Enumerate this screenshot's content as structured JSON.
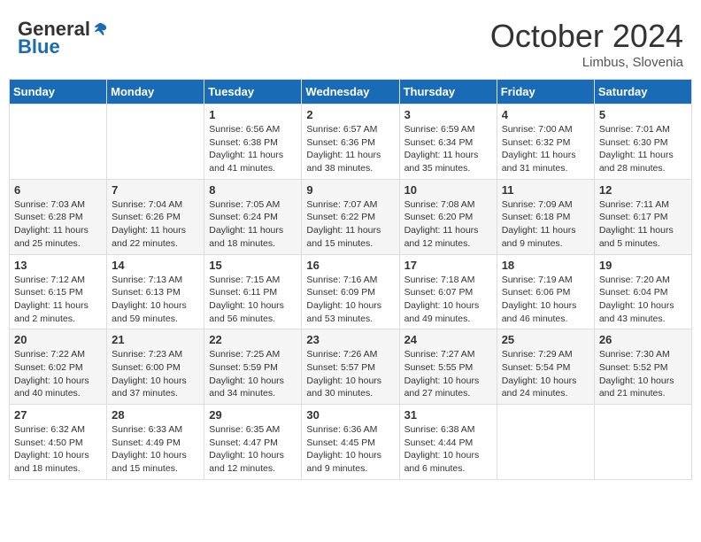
{
  "header": {
    "logo_general": "General",
    "logo_blue": "Blue",
    "month": "October 2024",
    "location": "Limbus, Slovenia"
  },
  "weekdays": [
    "Sunday",
    "Monday",
    "Tuesday",
    "Wednesday",
    "Thursday",
    "Friday",
    "Saturday"
  ],
  "weeks": [
    [
      {
        "day": "",
        "info": ""
      },
      {
        "day": "",
        "info": ""
      },
      {
        "day": "1",
        "info": "Sunrise: 6:56 AM\nSunset: 6:38 PM\nDaylight: 11 hours and 41 minutes."
      },
      {
        "day": "2",
        "info": "Sunrise: 6:57 AM\nSunset: 6:36 PM\nDaylight: 11 hours and 38 minutes."
      },
      {
        "day": "3",
        "info": "Sunrise: 6:59 AM\nSunset: 6:34 PM\nDaylight: 11 hours and 35 minutes."
      },
      {
        "day": "4",
        "info": "Sunrise: 7:00 AM\nSunset: 6:32 PM\nDaylight: 11 hours and 31 minutes."
      },
      {
        "day": "5",
        "info": "Sunrise: 7:01 AM\nSunset: 6:30 PM\nDaylight: 11 hours and 28 minutes."
      }
    ],
    [
      {
        "day": "6",
        "info": "Sunrise: 7:03 AM\nSunset: 6:28 PM\nDaylight: 11 hours and 25 minutes."
      },
      {
        "day": "7",
        "info": "Sunrise: 7:04 AM\nSunset: 6:26 PM\nDaylight: 11 hours and 22 minutes."
      },
      {
        "day": "8",
        "info": "Sunrise: 7:05 AM\nSunset: 6:24 PM\nDaylight: 11 hours and 18 minutes."
      },
      {
        "day": "9",
        "info": "Sunrise: 7:07 AM\nSunset: 6:22 PM\nDaylight: 11 hours and 15 minutes."
      },
      {
        "day": "10",
        "info": "Sunrise: 7:08 AM\nSunset: 6:20 PM\nDaylight: 11 hours and 12 minutes."
      },
      {
        "day": "11",
        "info": "Sunrise: 7:09 AM\nSunset: 6:18 PM\nDaylight: 11 hours and 9 minutes."
      },
      {
        "day": "12",
        "info": "Sunrise: 7:11 AM\nSunset: 6:17 PM\nDaylight: 11 hours and 5 minutes."
      }
    ],
    [
      {
        "day": "13",
        "info": "Sunrise: 7:12 AM\nSunset: 6:15 PM\nDaylight: 11 hours and 2 minutes."
      },
      {
        "day": "14",
        "info": "Sunrise: 7:13 AM\nSunset: 6:13 PM\nDaylight: 10 hours and 59 minutes."
      },
      {
        "day": "15",
        "info": "Sunrise: 7:15 AM\nSunset: 6:11 PM\nDaylight: 10 hours and 56 minutes."
      },
      {
        "day": "16",
        "info": "Sunrise: 7:16 AM\nSunset: 6:09 PM\nDaylight: 10 hours and 53 minutes."
      },
      {
        "day": "17",
        "info": "Sunrise: 7:18 AM\nSunset: 6:07 PM\nDaylight: 10 hours and 49 minutes."
      },
      {
        "day": "18",
        "info": "Sunrise: 7:19 AM\nSunset: 6:06 PM\nDaylight: 10 hours and 46 minutes."
      },
      {
        "day": "19",
        "info": "Sunrise: 7:20 AM\nSunset: 6:04 PM\nDaylight: 10 hours and 43 minutes."
      }
    ],
    [
      {
        "day": "20",
        "info": "Sunrise: 7:22 AM\nSunset: 6:02 PM\nDaylight: 10 hours and 40 minutes."
      },
      {
        "day": "21",
        "info": "Sunrise: 7:23 AM\nSunset: 6:00 PM\nDaylight: 10 hours and 37 minutes."
      },
      {
        "day": "22",
        "info": "Sunrise: 7:25 AM\nSunset: 5:59 PM\nDaylight: 10 hours and 34 minutes."
      },
      {
        "day": "23",
        "info": "Sunrise: 7:26 AM\nSunset: 5:57 PM\nDaylight: 10 hours and 30 minutes."
      },
      {
        "day": "24",
        "info": "Sunrise: 7:27 AM\nSunset: 5:55 PM\nDaylight: 10 hours and 27 minutes."
      },
      {
        "day": "25",
        "info": "Sunrise: 7:29 AM\nSunset: 5:54 PM\nDaylight: 10 hours and 24 minutes."
      },
      {
        "day": "26",
        "info": "Sunrise: 7:30 AM\nSunset: 5:52 PM\nDaylight: 10 hours and 21 minutes."
      }
    ],
    [
      {
        "day": "27",
        "info": "Sunrise: 6:32 AM\nSunset: 4:50 PM\nDaylight: 10 hours and 18 minutes."
      },
      {
        "day": "28",
        "info": "Sunrise: 6:33 AM\nSunset: 4:49 PM\nDaylight: 10 hours and 15 minutes."
      },
      {
        "day": "29",
        "info": "Sunrise: 6:35 AM\nSunset: 4:47 PM\nDaylight: 10 hours and 12 minutes."
      },
      {
        "day": "30",
        "info": "Sunrise: 6:36 AM\nSunset: 4:45 PM\nDaylight: 10 hours and 9 minutes."
      },
      {
        "day": "31",
        "info": "Sunrise: 6:38 AM\nSunset: 4:44 PM\nDaylight: 10 hours and 6 minutes."
      },
      {
        "day": "",
        "info": ""
      },
      {
        "day": "",
        "info": ""
      }
    ]
  ]
}
